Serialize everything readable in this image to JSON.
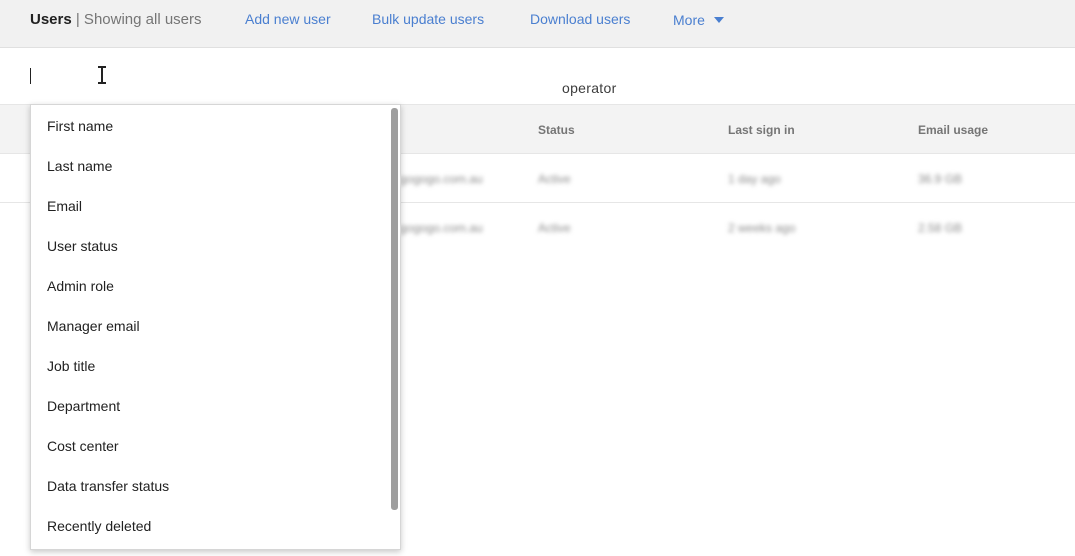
{
  "header": {
    "title_strong": "Users",
    "title_rest": " | Showing all users",
    "links": {
      "add_user": "Add new user",
      "bulk_update": "Bulk update users",
      "download": "Download users",
      "more": "More"
    }
  },
  "filter": {
    "input_value": "",
    "operator_label": "operator"
  },
  "table": {
    "columns": [
      "Status",
      "Last sign in",
      "Email usage"
    ],
    "rows": [
      {
        "email_partial": "gogogo.com.au",
        "status": "Active",
        "last_sign_in": "1 day ago",
        "email_usage": "36.9 GB"
      },
      {
        "email_partial": "gogogo.com.au",
        "status": "Active",
        "last_sign_in": "2 weeks ago",
        "email_usage": "2.58 GB"
      }
    ]
  },
  "dropdown": {
    "items": [
      "First name",
      "Last name",
      "Email",
      "User status",
      "Admin role",
      "Manager email",
      "Job title",
      "Department",
      "Cost center",
      "Data transfer status",
      "Recently deleted"
    ]
  }
}
